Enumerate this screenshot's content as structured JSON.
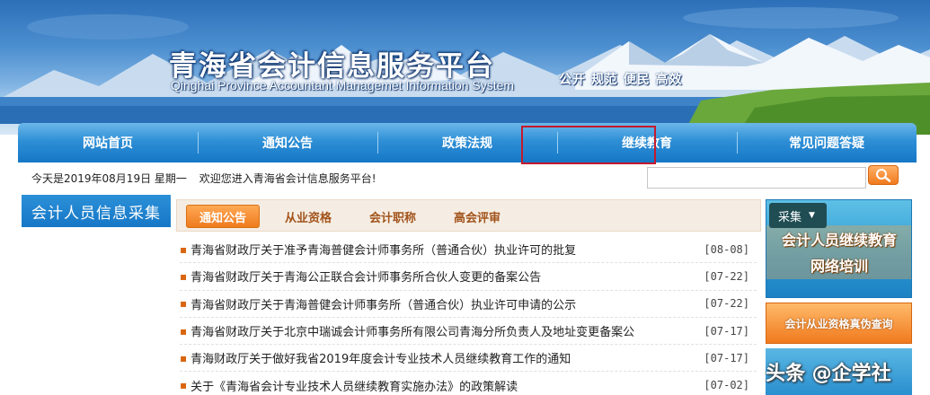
{
  "header": {
    "title": "青海省会计信息服务平台",
    "subtitle": "Qinghai Province Accountant Managemet Information System",
    "motto": "公开  规范  便民  高效"
  },
  "nav": {
    "items": [
      {
        "label": "网站首页"
      },
      {
        "label": "通知公告"
      },
      {
        "label": "政策法规"
      },
      {
        "label": "继续教育"
      },
      {
        "label": "常见问题答疑"
      }
    ],
    "highlighted": "继续教育"
  },
  "infobar": {
    "date": "今天是2019年08月19日  星期一",
    "welcome": "欢迎您进入青海省会计信息服务平台!"
  },
  "search": {
    "value": ""
  },
  "left_panel": {
    "title": "会计人员信息采集"
  },
  "tabs": [
    {
      "label": "通知公告",
      "active": true
    },
    {
      "label": "从业资格",
      "active": false
    },
    {
      "label": "会计职称",
      "active": false
    },
    {
      "label": "高会评审",
      "active": false
    }
  ],
  "news": [
    {
      "title": "青海省财政厅关于准予青海普健会计师事务所（普通合伙）执业许可的批复",
      "date": "[08-08]"
    },
    {
      "title": "青海省财政厅关于青海公正联合会计师事务所合伙人变更的备案公告",
      "date": "[07-22]"
    },
    {
      "title": "青海省财政厅关于青海普健会计师事务所（普通合伙）执业许可申请的公示",
      "date": "[07-22]"
    },
    {
      "title": "青海省财政厅关于北京中瑞诚会计师事务所有限公司青海分所负责人及地址变更备案公",
      "date": "[07-17]"
    },
    {
      "title": "青海财政厅关于做好我省2019年度会计专业技术人员继续教育工作的通知",
      "date": "[07-17]"
    },
    {
      "title": "关于《青海省会计专业技术人员继续教育实施办法》的政策解读",
      "date": "[07-02]"
    }
  ],
  "right_panel": {
    "collect_label": "采集",
    "banner_line1": "会计人员继续教育",
    "banner_line2": "网络培训",
    "verify_label": "会计从业资格真伪查询"
  },
  "watermark": "头条 @企学社",
  "colors": {
    "nav_blue": "#1677c6",
    "accent_orange": "#f07a1e",
    "highlight_red": "#c41a2c"
  }
}
